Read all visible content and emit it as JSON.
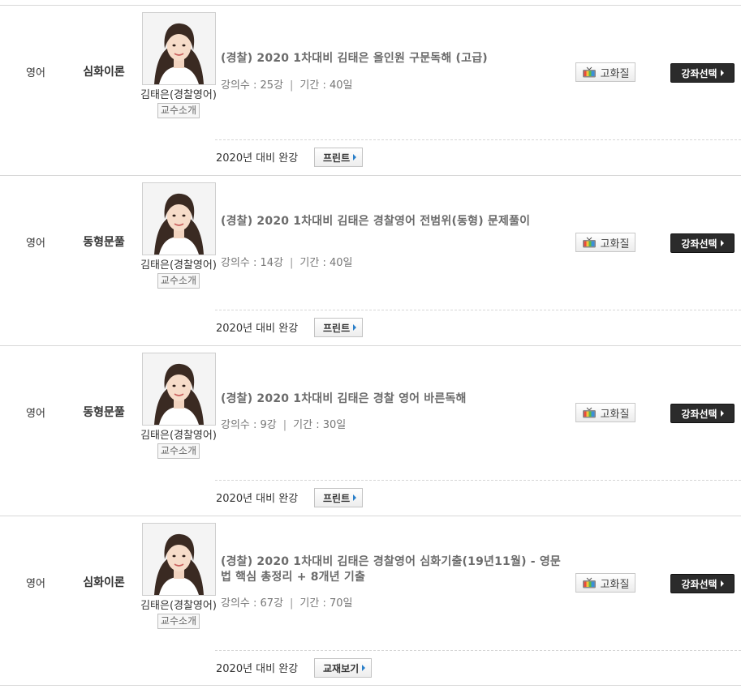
{
  "courses": [
    {
      "subject": "영어",
      "category": "심화이론",
      "professor_name": "김태은(경찰영어)",
      "professor_button": "교수소개",
      "title": "(경찰) 2020 1차대비 김태은 올인원 구문독해 (고급)",
      "lecture_count_label": "강의수 : 25강",
      "period_label": "기간 : 40일",
      "quality_button": "고화질",
      "select_button": "강좌선택",
      "note": "2020년 대비 완강",
      "material_button": "프린트"
    },
    {
      "subject": "영어",
      "category": "동형문풀",
      "professor_name": "김태은(경찰영어)",
      "professor_button": "교수소개",
      "title": "(경찰) 2020 1차대비 김태은 경찰영어 전범위(동형) 문제풀이",
      "lecture_count_label": "강의수 : 14강",
      "period_label": "기간 : 40일",
      "quality_button": "고화질",
      "select_button": "강좌선택",
      "note": "2020년 대비 완강",
      "material_button": "프린트"
    },
    {
      "subject": "영어",
      "category": "동형문풀",
      "professor_name": "김태은(경찰영어)",
      "professor_button": "교수소개",
      "title": "(경찰) 2020 1차대비 김태은 경찰 영어 바른독해",
      "lecture_count_label": "강의수 : 9강",
      "period_label": "기간 : 30일",
      "quality_button": "고화질",
      "select_button": "강좌선택",
      "note": "2020년 대비 완강",
      "material_button": "프린트"
    },
    {
      "subject": "영어",
      "category": "심화이론",
      "professor_name": "김태은(경찰영어)",
      "professor_button": "교수소개",
      "title": "(경찰) 2020 1차대비 김태은 경찰영어 심화기출(19년11월) - 영문법 핵심 총정리 + 8개년 기출",
      "lecture_count_label": "강의수 : 67강",
      "period_label": "기간 : 70일",
      "quality_button": "고화질",
      "select_button": "강좌선택",
      "note": "2020년 대비 완강",
      "material_button": "교재보기"
    }
  ],
  "colors": {
    "select_button_bg": "#2b2b2b",
    "arrow_blue": "#2a7fc9",
    "title_text": "#6b6b6b",
    "row_border": "#d8d8d8"
  },
  "icons": {
    "quality": "tv-icon",
    "professor_photo": "avatar"
  }
}
